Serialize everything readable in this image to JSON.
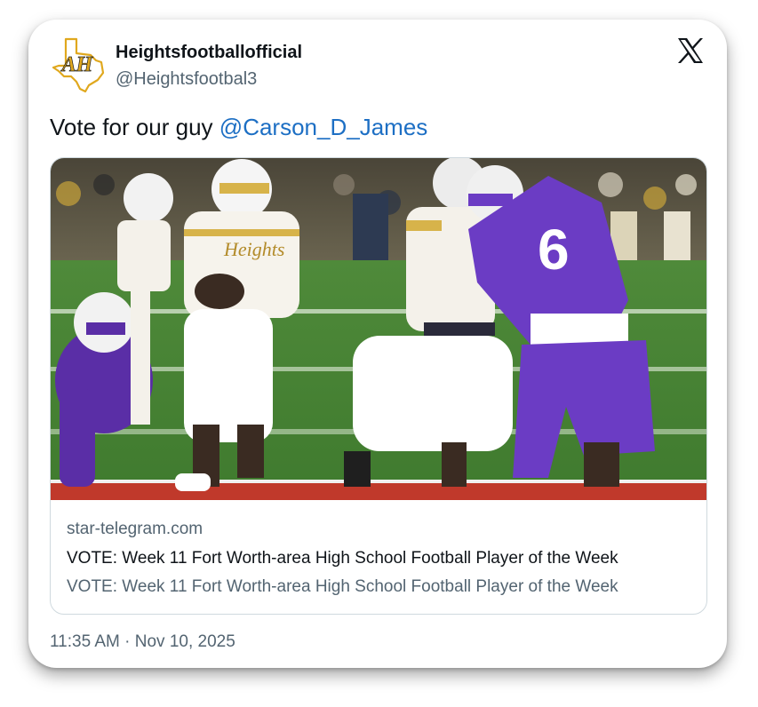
{
  "author": {
    "display_name": "Heightsfootballofficial",
    "handle": "@Heightsfootbal3",
    "avatar_logo_text": "AH"
  },
  "tweet": {
    "text": "Vote for our guy ",
    "mention": "@Carson_D_James"
  },
  "link_card": {
    "image_icon": "football-game-photo",
    "domain": "star-telegram.com",
    "title": "VOTE: Week 11 Fort Worth-area High School Football Player of the Week",
    "description": "VOTE: Week 11 Fort Worth-area High School Football Player of the Week"
  },
  "timestamp": "11:35 AM · Nov 10, 2025",
  "icons": {
    "platform": "x-logo-icon",
    "avatar": "texas-ah-logo"
  },
  "colors": {
    "mention": "#1d6fc4",
    "secondary_text": "#536471",
    "primary_text": "#0f1419",
    "logo_gold": "#e0a81e"
  }
}
